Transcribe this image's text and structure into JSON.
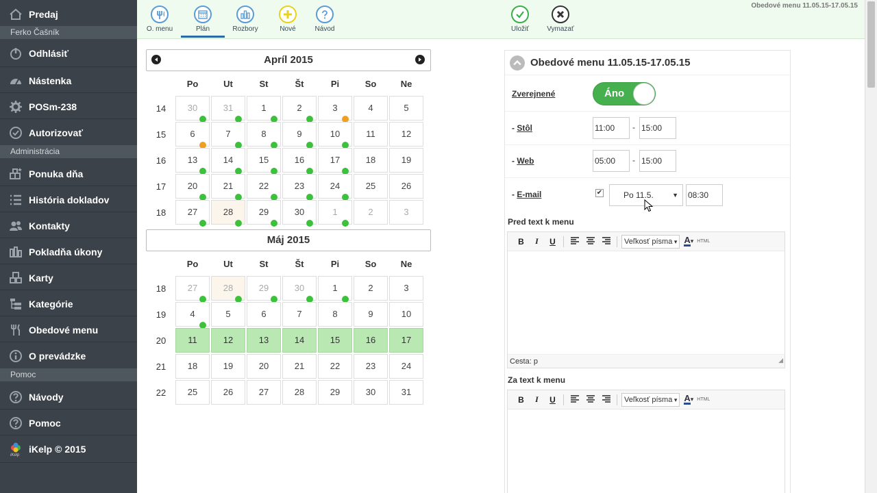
{
  "sidebar": {
    "items": [
      {
        "label": "Predaj",
        "icon": "home-icon"
      },
      {
        "label": "Odhlásiť",
        "icon": "power-icon"
      },
      {
        "label": "Nástenka",
        "icon": "dashboard-icon"
      },
      {
        "label": "POSm-238",
        "icon": "gear-icon"
      },
      {
        "label": "Autorizovať",
        "icon": "check-circle-icon"
      },
      {
        "label": "Ponuka dňa",
        "icon": "offer-icon"
      },
      {
        "label": "História dokladov",
        "icon": "list-icon"
      },
      {
        "label": "Kontakty",
        "icon": "users-icon"
      },
      {
        "label": "Pokladňa úkony",
        "icon": "bars-icon"
      },
      {
        "label": "Karty",
        "icon": "cards-icon"
      },
      {
        "label": "Kategórie",
        "icon": "tree-icon"
      },
      {
        "label": "Obedové menu",
        "icon": "cutlery-icon"
      },
      {
        "label": "O prevádzke",
        "icon": "info-icon"
      },
      {
        "label": "Návody",
        "icon": "help-icon"
      },
      {
        "label": "Pomoc",
        "icon": "help-icon"
      },
      {
        "label": "iKelp © 2015",
        "icon": "ikelp-logo-icon"
      }
    ],
    "headers": {
      "user": "Ferko Čašník",
      "admin": "Administrácia",
      "help": "Pomoc"
    },
    "logo_caption": "iKelp"
  },
  "toolbar": {
    "title": "Obedové menu 11.05.15-17.05.15",
    "buttons": [
      {
        "label": "O. menu",
        "icon": "cutlery-icon",
        "color": "#5b9bd5"
      },
      {
        "label": "Plán",
        "icon": "calendar-icon",
        "color": "#5b9bd5"
      },
      {
        "label": "Rozbory",
        "icon": "chart-icon",
        "color": "#5b9bd5"
      },
      {
        "label": "Nové",
        "icon": "plus-icon",
        "color": "#e8d21a"
      },
      {
        "label": "Návod",
        "icon": "question-icon",
        "color": "#5b9bd5"
      },
      {
        "label": "Uložiť",
        "icon": "check-icon",
        "color": "#3cae4a"
      },
      {
        "label": "Vymazať",
        "icon": "delete-icon",
        "color": "#333333"
      }
    ]
  },
  "calendar": {
    "dows": [
      "Po",
      "Ut",
      "St",
      "Št",
      "Pi",
      "So",
      "Ne"
    ],
    "months": [
      {
        "title": "Apríl 2015",
        "weeks": [
          {
            "wk": "14",
            "days": [
              [
                "30",
                "o",
                "g"
              ],
              [
                "31",
                "o",
                "g"
              ],
              [
                "1",
                "",
                "g"
              ],
              [
                "2",
                "",
                "g"
              ],
              [
                "3",
                "",
                "o"
              ],
              [
                "4",
                "",
                ""
              ],
              [
                "5",
                "",
                ""
              ]
            ]
          },
          {
            "wk": "15",
            "days": [
              [
                "6",
                "",
                "o"
              ],
              [
                "7",
                "",
                "g"
              ],
              [
                "8",
                "",
                "g"
              ],
              [
                "9",
                "",
                "g"
              ],
              [
                "10",
                "",
                "g"
              ],
              [
                "11",
                "",
                ""
              ],
              [
                "12",
                "",
                ""
              ]
            ]
          },
          {
            "wk": "16",
            "days": [
              [
                "13",
                "",
                "g"
              ],
              [
                "14",
                "",
                "g"
              ],
              [
                "15",
                "",
                "g"
              ],
              [
                "16",
                "",
                "g"
              ],
              [
                "17",
                "",
                "g"
              ],
              [
                "18",
                "",
                ""
              ],
              [
                "19",
                "",
                ""
              ]
            ]
          },
          {
            "wk": "17",
            "days": [
              [
                "20",
                "",
                "g"
              ],
              [
                "21",
                "",
                "g"
              ],
              [
                "22",
                "",
                "g"
              ],
              [
                "23",
                "",
                "g"
              ],
              [
                "24",
                "",
                "g"
              ],
              [
                "25",
                "",
                ""
              ],
              [
                "26",
                "",
                ""
              ]
            ]
          },
          {
            "wk": "18",
            "days": [
              [
                "27",
                "",
                "g"
              ],
              [
                "28",
                "t",
                "g"
              ],
              [
                "29",
                "",
                "g"
              ],
              [
                "30",
                "",
                "g"
              ],
              [
                "1",
                "o",
                "g"
              ],
              [
                "2",
                "o",
                ""
              ],
              [
                "3",
                "o",
                ""
              ]
            ]
          }
        ]
      },
      {
        "title": "Máj 2015",
        "weeks": [
          {
            "wk": "18",
            "days": [
              [
                "27",
                "o",
                "g"
              ],
              [
                "28",
                "ot",
                "g"
              ],
              [
                "29",
                "o",
                "g"
              ],
              [
                "30",
                "o",
                "g"
              ],
              [
                "1",
                "",
                "g"
              ],
              [
                "2",
                "",
                ""
              ],
              [
                "3",
                "",
                ""
              ]
            ]
          },
          {
            "wk": "19",
            "days": [
              [
                "4",
                "",
                "g"
              ],
              [
                "5",
                "",
                ""
              ],
              [
                "6",
                "",
                ""
              ],
              [
                "7",
                "",
                ""
              ],
              [
                "8",
                "",
                ""
              ],
              [
                "9",
                "",
                ""
              ],
              [
                "10",
                "",
                ""
              ]
            ]
          },
          {
            "wk": "20",
            "days": [
              [
                "11",
                "s",
                ""
              ],
              [
                "12",
                "s",
                ""
              ],
              [
                "13",
                "s",
                ""
              ],
              [
                "14",
                "s",
                ""
              ],
              [
                "15",
                "s",
                ""
              ],
              [
                "16",
                "s",
                ""
              ],
              [
                "17",
                "s",
                ""
              ]
            ]
          },
          {
            "wk": "21",
            "days": [
              [
                "18",
                "",
                ""
              ],
              [
                "19",
                "",
                ""
              ],
              [
                "20",
                "",
                ""
              ],
              [
                "21",
                "",
                ""
              ],
              [
                "22",
                "",
                ""
              ],
              [
                "23",
                "",
                ""
              ],
              [
                "24",
                "",
                ""
              ]
            ]
          },
          {
            "wk": "22",
            "days": [
              [
                "25",
                "",
                ""
              ],
              [
                "26",
                "",
                ""
              ],
              [
                "27",
                "",
                ""
              ],
              [
                "28",
                "",
                ""
              ],
              [
                "29",
                "",
                ""
              ],
              [
                "30",
                "",
                ""
              ],
              [
                "31",
                "",
                ""
              ]
            ]
          }
        ]
      }
    ]
  },
  "panel": {
    "title": "Obedové menu 11.05.15-17.05.15",
    "published_label": "Zverejnené",
    "published_value": "Áno",
    "stol_label": "Stôl",
    "stol_from": "11:00",
    "stol_to": "15:00",
    "web_label": "Web",
    "web_from": "05:00",
    "web_to": "15:00",
    "email_label": "E-mail",
    "email_checked": "✔",
    "email_day": "Po 11.5.",
    "email_time": "08:30",
    "dash": "-",
    "prefix": "- ",
    "pre_text_label": "Pred text k menu",
    "post_text_label": "Za text k menu",
    "path_label": "Cesta: p",
    "editor": {
      "bold": "B",
      "italic": "I",
      "underline": "U",
      "font_size": "Veľkosť písma",
      "font_color": "A",
      "html": "HTML"
    }
  }
}
